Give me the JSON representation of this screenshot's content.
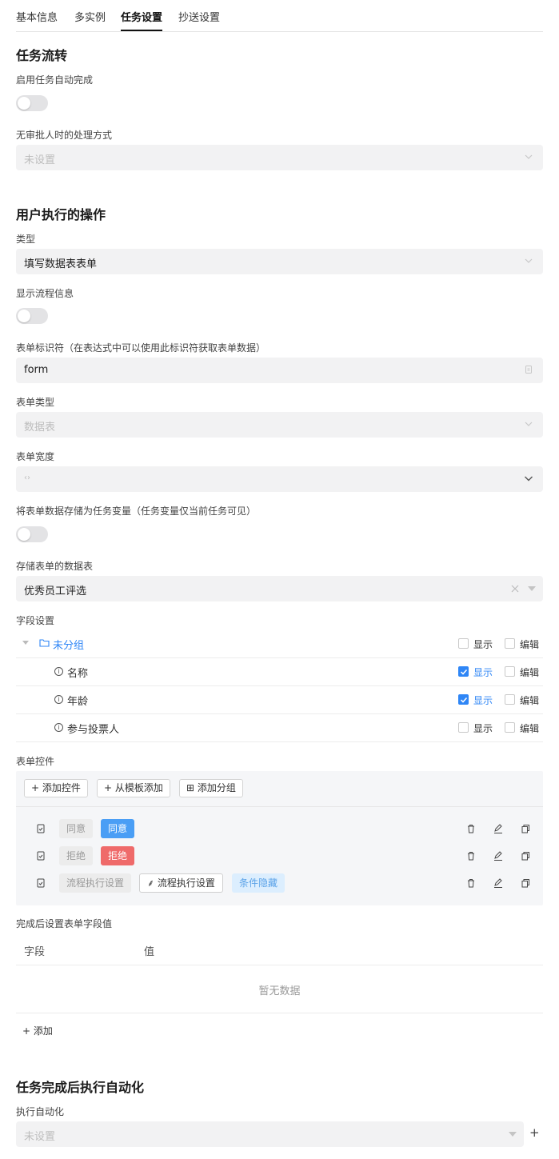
{
  "tabs": [
    "基本信息",
    "多实例",
    "任务设置",
    "抄送设置"
  ],
  "task_flow": {
    "title": "任务流转",
    "auto_complete_label": "启用任务自动完成",
    "no_approver_label": "无审批人时的处理方式",
    "no_approver_placeholder": "未设置"
  },
  "user_ops": {
    "title": "用户执行的操作",
    "type_label": "类型",
    "type_value": "填写数据表表单",
    "show_flow_label": "显示流程信息",
    "form_id_label": "表单标识符（在表达式中可以使用此标识符获取表单数据）",
    "form_id_value": "form",
    "form_type_label": "表单类型",
    "form_type_placeholder": "数据表",
    "form_width_label": "表单宽度",
    "form_width_placeholder": "‹›",
    "store_var_label": "将表单数据存储为任务变量（任务变量仅当前任务可见）",
    "store_table_label": "存储表单的数据表",
    "store_table_value": "优秀员工评选",
    "field_settings_label": "字段设置",
    "group_name": "未分组",
    "show_text": "显示",
    "edit_text": "编辑",
    "fields": [
      {
        "name": "名称",
        "show": true,
        "edit": false
      },
      {
        "name": "年龄",
        "show": true,
        "edit": false
      },
      {
        "name": "参与投票人",
        "show": false,
        "edit": false
      }
    ],
    "controls_label": "表单控件",
    "add_control": "添加控件",
    "add_from_template": "从模板添加",
    "add_group": "添加分组",
    "controls": [
      {
        "name": "同意",
        "tag": "同意"
      },
      {
        "name": "拒绝",
        "tag": "拒绝"
      },
      {
        "name": "流程执行设置",
        "tag": "流程执行设置",
        "extra": "条件隐藏"
      }
    ],
    "after_label": "完成后设置表单字段值",
    "col_field": "字段",
    "col_value": "值",
    "empty_text": "暂无数据",
    "add_text": "添加"
  },
  "automation": {
    "title": "任务完成后执行自动化",
    "exec_label": "执行自动化",
    "exec_placeholder": "未设置"
  },
  "colors": {
    "accent": "#2f86f6",
    "danger": "#ef6a6a"
  }
}
